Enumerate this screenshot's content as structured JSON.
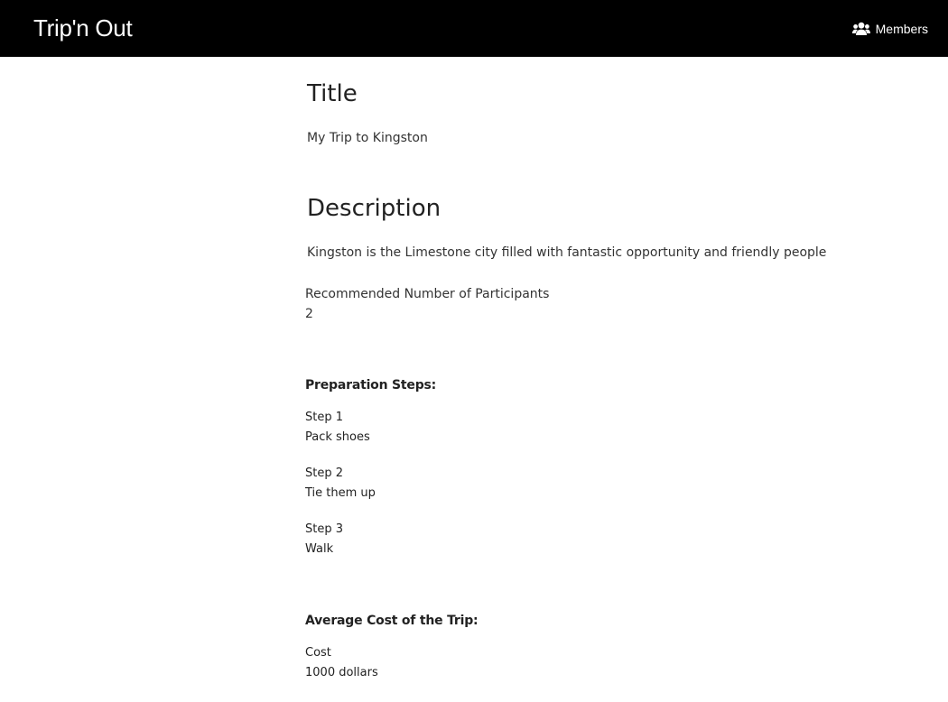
{
  "navbar": {
    "brand": "Trip'n Out",
    "members_label": "Members",
    "members_icon": "users-icon",
    "background": "#000000"
  },
  "trip": {
    "title_heading": "Title",
    "title_value": "My Trip to Kingston",
    "description_heading": "Description",
    "description_value": "Kingston is the Limestone city filled with fantastic opportunity and friendly people",
    "participants_label": "Recommended Number of Participants",
    "participants_value": "2"
  },
  "preparation": {
    "heading": "Preparation Steps:",
    "steps": [
      {
        "label": "Step 1",
        "text": "Pack shoes"
      },
      {
        "label": "Step 2",
        "text": "Tie them up"
      },
      {
        "label": "Step 3",
        "text": "Walk"
      }
    ]
  },
  "cost": {
    "heading": "Average Cost of the Trip:",
    "label": "Cost",
    "value": "1000 dollars"
  }
}
